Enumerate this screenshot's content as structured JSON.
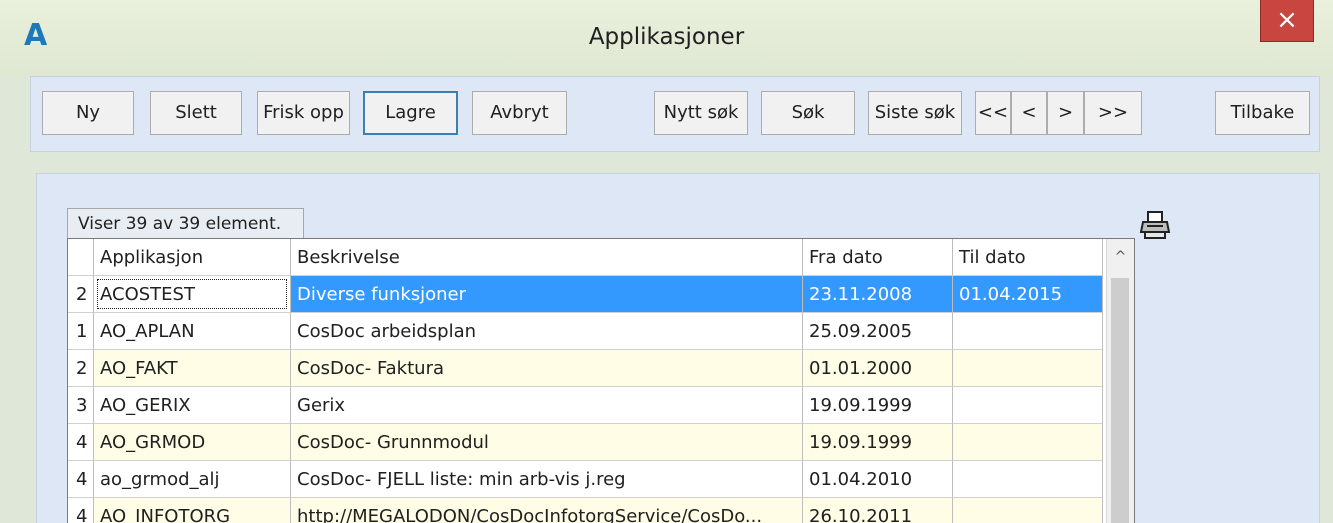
{
  "window": {
    "title": "Applikasjoner",
    "icon_letter": "A",
    "close_symbol": "×"
  },
  "toolbar": {
    "ny": "Ny",
    "slett": "Slett",
    "frisk_opp": "Frisk opp",
    "lagre": "Lagre",
    "avbryt": "Avbryt",
    "nytt_sok": "Nytt søk",
    "sok": "Søk",
    "siste_sok": "Siste søk",
    "first": "<<",
    "prev": "<",
    "next": ">",
    "last": ">>",
    "tilbake": "Tilbake"
  },
  "status_text": "Viser 39 av 39 element.",
  "grid": {
    "columns": [
      "Applikasjon",
      "Beskrivelse",
      "Fra dato",
      "Til dato"
    ],
    "rows": [
      {
        "idx": "2",
        "app": "ACOSTEST",
        "desc": "Diverse funksjoner",
        "fra": "23.11.2008",
        "til": "01.04.2015"
      },
      {
        "idx": "1",
        "app": "AO_APLAN",
        "desc": "CosDoc arbeidsplan",
        "fra": "25.09.2005",
        "til": ""
      },
      {
        "idx": "2",
        "app": "AO_FAKT",
        "desc": "CosDoc- Faktura",
        "fra": "01.01.2000",
        "til": ""
      },
      {
        "idx": "3",
        "app": "AO_GERIX",
        "desc": "Gerix",
        "fra": "19.09.1999",
        "til": ""
      },
      {
        "idx": "4",
        "app": "AO_GRMOD",
        "desc": "CosDoc- Grunnmodul",
        "fra": "19.09.1999",
        "til": ""
      },
      {
        "idx": "4",
        "app": "ao_grmod_alj",
        "desc": "CosDoc- FJELL liste: min arb-vis j.reg",
        "fra": "01.04.2010",
        "til": ""
      },
      {
        "idx": "4",
        "app": "AO_INFOTORG",
        "desc": "http://MEGALODON/CosDocInfotorgService/CosDo...",
        "fra": "26.10.2011",
        "til": ""
      }
    ]
  },
  "colors": {
    "selection": "#3399ff",
    "alt_row": "#fffde6",
    "close": "#c8463f"
  },
  "icons": {
    "scroll_up": "^",
    "print": "printer-icon"
  }
}
